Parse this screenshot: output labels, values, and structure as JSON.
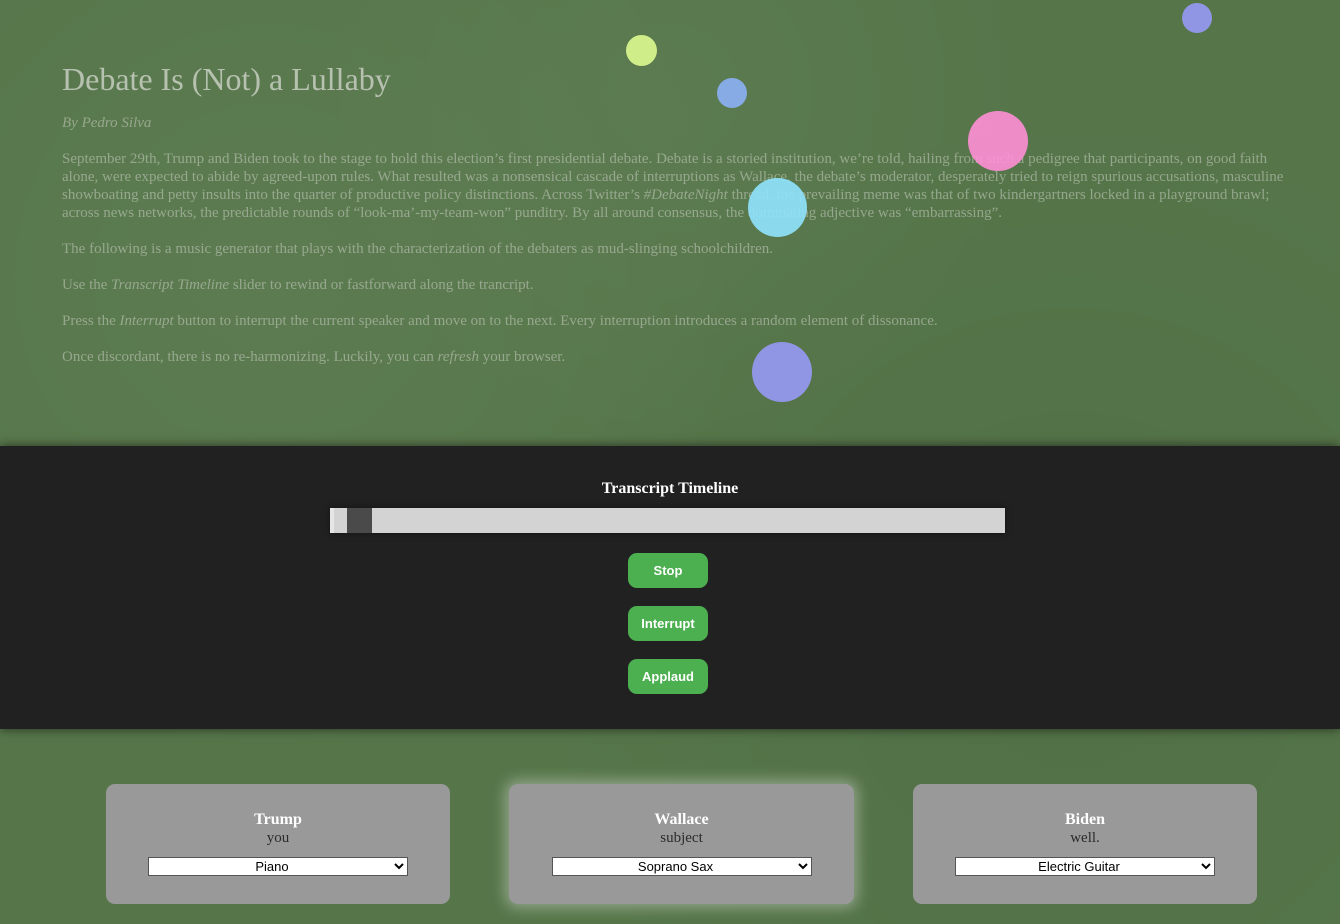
{
  "intro": {
    "title": "Debate Is (Not) a Lullaby",
    "byline": "By Pedro Silva",
    "p1_a": "September 29th, Trump and Biden took to the stage to hold this election’s first presidential debate. Debate is a storied institution, we’re told, hailing from such a pedigree that participants, on good faith alone, were expected to abide by agreed-upon rules. What resulted was a nonsensical cascade of interruptions as Wallace, the debate’s moderator, desperately tried to reign spurious accusations, masculine showboating and petty insults into the quarter of productive policy distinctions. Across Twitter’s ",
    "p1_em": "#DebateNight",
    "p1_b": " thread, the prevailing meme was that of two kindergartners locked in a playground brawl; across news networks, the predictable rounds of “look-ma’-my-team-won” punditry. By all around consensus, the dominating adjective was “embarrassing”.",
    "p2": "The following is a music generator that plays with the characterization of the debaters as mud-slinging schoolchildren.",
    "p3_a": "Use the ",
    "p3_em": "Transcript Timeline",
    "p3_b": " slider to rewind or fastforward along the trancript.",
    "p4_a": "Press the ",
    "p4_em": "Interrupt",
    "p4_b": " button to interrupt the current speaker and move on to the next. Every interruption introduces a random element of dissonance.",
    "p5_a": "Once discordant, there is no re-harmonizing. Luckily, you can ",
    "p5_em": "refresh",
    "p5_b": " your browser."
  },
  "controls": {
    "timeline_title": "Transcript Timeline",
    "timeline_progress": 0.02,
    "stop_label": "Stop",
    "interrupt_label": "Interrupt",
    "applaud_label": "Applaud"
  },
  "speakers": [
    {
      "name": "Trump",
      "word": "you",
      "instrument": "Piano",
      "active": false
    },
    {
      "name": "Wallace",
      "word": "subject",
      "instrument": "Soprano Sax",
      "active": true
    },
    {
      "name": "Biden",
      "word": "well.",
      "instrument": "Electric Guitar",
      "active": false
    }
  ],
  "colors": {
    "background": "#56764a",
    "control_band": "#212121",
    "button": "#4caf50",
    "card": "#999999",
    "bubble_yellow": "#dcfa8e",
    "bubble_blue": "#8fb4ff",
    "bubble_pink": "#ff8fd6",
    "bubble_cyan": "#8fe3ff",
    "bubble_violet": "#9a9cff"
  }
}
